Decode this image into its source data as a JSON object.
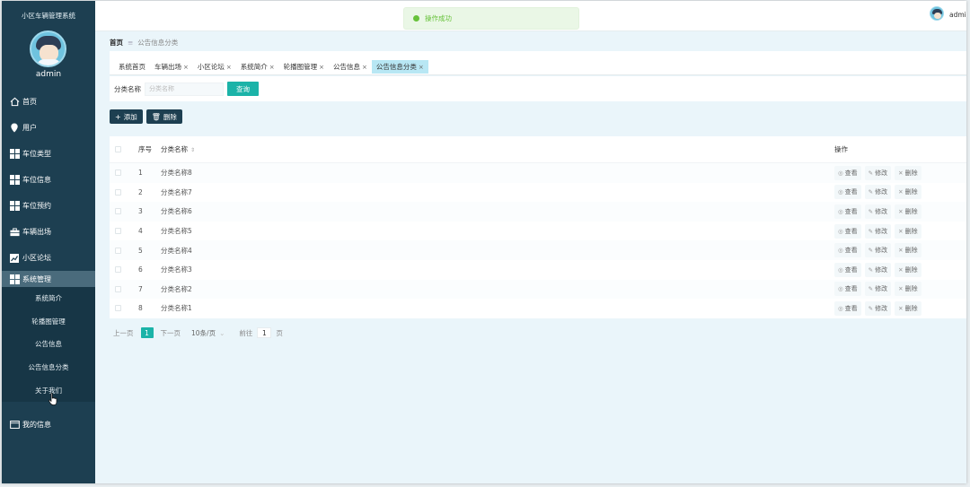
{
  "app": {
    "title": "小区车辆管理系统",
    "user": "admin",
    "top_user": "admin"
  },
  "toast": {
    "message": "操作成功"
  },
  "sidebar": {
    "items": [
      {
        "label": "首页",
        "icon": "home-icon"
      },
      {
        "label": "用户",
        "icon": "location-pin-icon"
      },
      {
        "label": "车位类型",
        "icon": "grid-icon"
      },
      {
        "label": "车位信息",
        "icon": "grid-icon"
      },
      {
        "label": "车位预约",
        "icon": "grid-icon"
      },
      {
        "label": "车辆出场",
        "icon": "briefcase-icon"
      },
      {
        "label": "小区论坛",
        "icon": "chart-icon"
      },
      {
        "label": "系统管理",
        "icon": "grid-icon"
      }
    ],
    "submenu": [
      "系统简介",
      "轮播图管理",
      "公告信息",
      "公告信息分类",
      "关于我们"
    ],
    "bottom": {
      "label": "我的信息",
      "icon": "id-card-icon"
    }
  },
  "breadcrumb": {
    "home": "首页",
    "separator": "≡",
    "current": "公告信息分类"
  },
  "tabs": [
    {
      "label": "系统首页",
      "closable": false
    },
    {
      "label": "车辆出场",
      "closable": true
    },
    {
      "label": "小区论坛",
      "closable": true
    },
    {
      "label": "系统简介",
      "closable": true
    },
    {
      "label": "轮播图管理",
      "closable": true
    },
    {
      "label": "公告信息",
      "closable": true
    },
    {
      "label": "公告信息分类",
      "closable": true
    }
  ],
  "search": {
    "label": "分类名称",
    "placeholder": "分类名称",
    "button": "查询"
  },
  "actions": {
    "add": "添加",
    "delete": "删除"
  },
  "table": {
    "headers": {
      "index": "序号",
      "name": "分类名称",
      "ops": "操作"
    },
    "rows": [
      {
        "index": "1",
        "name": "分类名称8"
      },
      {
        "index": "2",
        "name": "分类名称7"
      },
      {
        "index": "3",
        "name": "分类名称6"
      },
      {
        "index": "4",
        "name": "分类名称5"
      },
      {
        "index": "5",
        "name": "分类名称4"
      },
      {
        "index": "6",
        "name": "分类名称3"
      },
      {
        "index": "7",
        "name": "分类名称2"
      },
      {
        "index": "8",
        "name": "分类名称1"
      }
    ],
    "op_labels": {
      "view": "查看",
      "edit": "修改",
      "delete": "删除"
    }
  },
  "pagination": {
    "prev": "上一页",
    "current": "1",
    "next": "下一页",
    "page_size": "10条/页",
    "goto_label": "前往",
    "goto_value": "1",
    "page_unit": "页"
  },
  "colors": {
    "sidebar": "#1d3f51",
    "accent": "#1bb3a8",
    "active_tab": "#b8e7f4",
    "success": "#67c23a"
  }
}
